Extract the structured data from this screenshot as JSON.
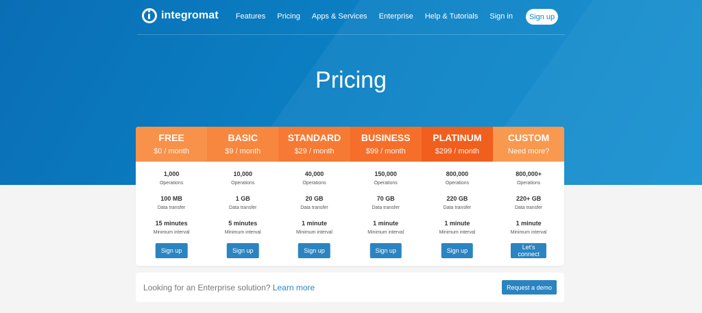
{
  "brand": {
    "name": "integromat"
  },
  "nav": {
    "links": [
      "Features",
      "Pricing",
      "Apps & Services",
      "Enterprise",
      "Help & Tutorials",
      "Sign in"
    ],
    "signup": "Sign up"
  },
  "page": {
    "title": "Pricing"
  },
  "plans": [
    {
      "name": "FREE",
      "price": "$0 / month",
      "color": "#f8914a",
      "ops": "1,000",
      "ops_label": "Operations",
      "transfer": "100 MB",
      "transfer_label": "Data transfer",
      "interval": "15 minutes",
      "interval_label": "Minimum interval",
      "button": "Sign up"
    },
    {
      "name": "BASIC",
      "price": "$9 / month",
      "color": "#f7863f",
      "ops": "10,000",
      "ops_label": "Operations",
      "transfer": "1 GB",
      "transfer_label": "Data transfer",
      "interval": "5 minutes",
      "interval_label": "Minimum interval",
      "button": "Sign up"
    },
    {
      "name": "STANDARD",
      "price": "$29 / month",
      "color": "#f67a33",
      "ops": "40,000",
      "ops_label": "Operations",
      "transfer": "20 GB",
      "transfer_label": "Data transfer",
      "interval": "1 minute",
      "interval_label": "Minimum interval",
      "button": "Sign up"
    },
    {
      "name": "BUSINESS",
      "price": "$99 / month",
      "color": "#f56f2b",
      "ops": "150,000",
      "ops_label": "Operations",
      "transfer": "70 GB",
      "transfer_label": "Data transfer",
      "interval": "1 minute",
      "interval_label": "Minimum interval",
      "button": "Sign up"
    },
    {
      "name": "PLATINUM",
      "price": "$299 / month",
      "color": "#f05f1d",
      "ops": "800,000",
      "ops_label": "Operations",
      "transfer": "220 GB",
      "transfer_label": "Data transfer",
      "interval": "1 minute",
      "interval_label": "Minimum interval",
      "button": "Sign up"
    },
    {
      "name": "CUSTOM",
      "price": "Need more?",
      "color": "#f8994f",
      "ops": "800,000+",
      "ops_label": "Operations",
      "transfer": "220+ GB",
      "transfer_label": "Data transfer",
      "interval": "1 minute",
      "interval_label": "Minimum interval",
      "button": "Let's connect"
    }
  ],
  "enterprise": {
    "text": "Looking for an Enterprise solution?",
    "link": "Learn more",
    "button": "Request a demo"
  },
  "colors": {
    "hero": "#0b7fc3",
    "button": "#2b84c0"
  }
}
